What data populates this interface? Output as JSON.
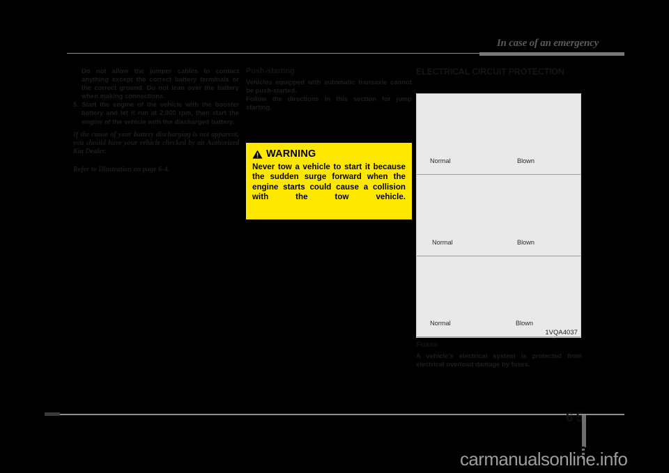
{
  "header": {
    "title": "In case of an emergency"
  },
  "left_column": {
    "continued_note": "Do not allow the jumper cables to contact anything except the correct battery terminals or the correct ground. Do not lean over the battery when making connections.",
    "step": {
      "number": "5.",
      "text": "Start the engine of the vehicle with the booster battery and let it run at 2,000 rpm, then start the engine of the vehicle with the discharged battery."
    },
    "italic_note": "If the cause of your battery discharging is not apparent, you should have your vehicle checked by an Authorized Kia Dealer.",
    "refer_note": "Refer to Illustration on page 6-4."
  },
  "middle_column": {
    "heading": "Push-starting",
    "paragraph1": "Vehicles equipped with automatic transaxle cannot be push-started.",
    "paragraph2": "Follow the directions in this section for jump starting.",
    "warning": {
      "icon": "warning-triangle-icon",
      "label": "WARNING",
      "text": "Never tow a vehicle to start it because the sudden surge forward when the engine starts could cause a collision with the tow vehicle.",
      "background_color": "#ffe800"
    }
  },
  "right_column": {
    "heading": "ELECTRICAL CIRCUIT PROTECTION",
    "figure": {
      "panels": [
        {
          "normal_label": "Normal",
          "blown_label": "Blown"
        },
        {
          "normal_label": "Normal",
          "blown_label": "Blown"
        },
        {
          "normal_label": "Normal",
          "blown_label": "Blown"
        }
      ],
      "code": "1VQA4037"
    },
    "subheading": "Fuses",
    "paragraph": "A vehicle's electrical system is protected from electrical overload damage by fuses."
  },
  "footer": {
    "page_chapter": "6",
    "page_number": "5",
    "watermark": "carmanualsonline.info"
  }
}
